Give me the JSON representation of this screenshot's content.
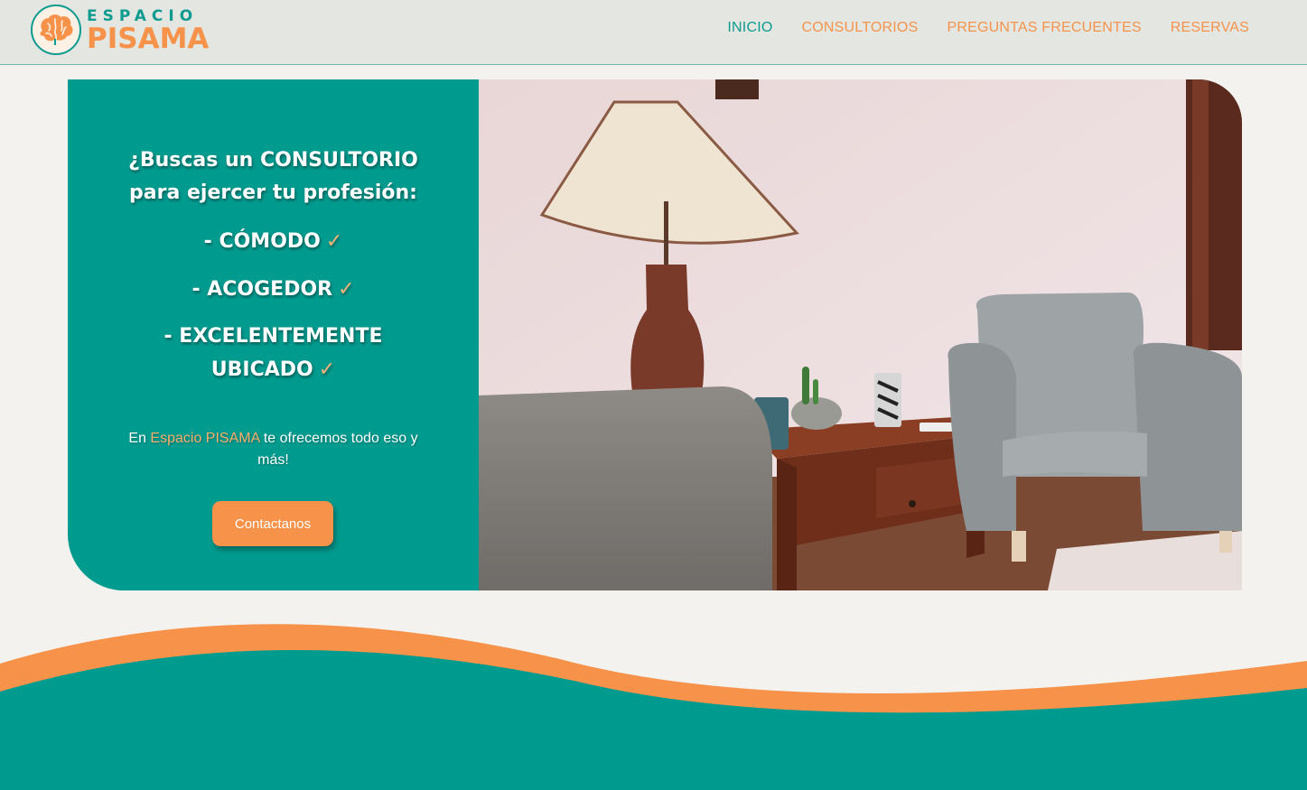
{
  "header": {
    "logo_top": "ESPACIO",
    "logo_bottom": "PISAMA",
    "nav": [
      {
        "label": "INICIO"
      },
      {
        "label": "CONSULTORIOS"
      },
      {
        "label": "PREGUNTAS FRECUENTES"
      },
      {
        "label": "RESERVAS"
      }
    ]
  },
  "hero": {
    "headline_line1": "¿Buscas un CONSULTORIO",
    "headline_line2": "para ejercer tu profesión:",
    "bullets": [
      {
        "text": "- CÓMODO"
      },
      {
        "text": "- ACOGEDOR"
      },
      {
        "text_line1": "- EXCELENTEMENTE",
        "text_line2": "UBICADO"
      }
    ],
    "check_mark": "✓",
    "intro_before": "En ",
    "intro_brand": "Espacio PISAMA",
    "intro_after": " te ofrecemos todo eso y más!",
    "cta_label": "Contactanos"
  },
  "colors": {
    "teal": "#009b8f",
    "orange": "#f6924a",
    "header_bg": "#e3e6e1",
    "page_bg": "#f4f2ee"
  },
  "icons": {
    "logo": "brain-logo-icon"
  }
}
